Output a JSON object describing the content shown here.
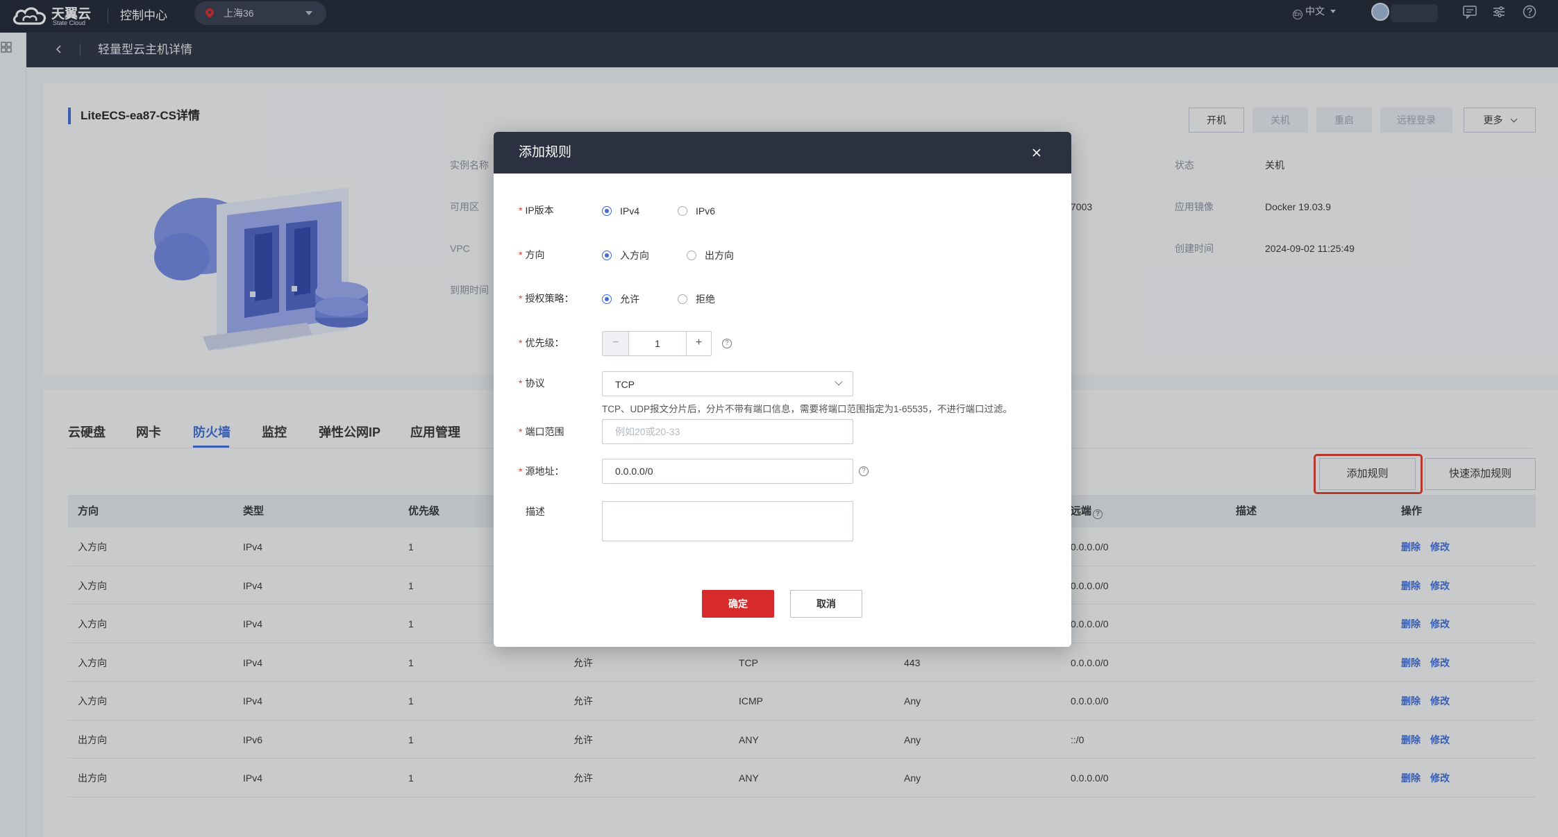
{
  "topbar": {
    "brand_name": "天翼云",
    "brand_sub": "State Cloud",
    "console_label": "控制中心",
    "region_label": "上海36",
    "language_label": "中文",
    "language_icon_text": "En"
  },
  "subbar": {
    "title": "轻量型云主机详情"
  },
  "detail": {
    "title": "LiteECS-ea87-CS详情",
    "fields_left": [
      {
        "label": "实例名称"
      },
      {
        "label": "可用区"
      },
      {
        "label": "VPC"
      },
      {
        "label": "到期时间"
      }
    ],
    "partial_value": "7003",
    "fields_right": [
      {
        "label": "状态",
        "value": "关机"
      },
      {
        "label": "应用镜像",
        "value": "Docker 19.03.9"
      },
      {
        "label": "创建时间",
        "value": "2024-09-02 11:25:49"
      }
    ],
    "buttons": {
      "start": "开机",
      "shutdown": "关机",
      "restart": "重启",
      "remote_login": "远程登录",
      "more": "更多"
    }
  },
  "tabs": [
    {
      "label": "云硬盘"
    },
    {
      "label": "网卡"
    },
    {
      "label": "防火墙"
    },
    {
      "label": "监控"
    },
    {
      "label": "弹性公网IP"
    },
    {
      "label": "应用管理"
    }
  ],
  "firewall": {
    "add_rule_label": "添加规则",
    "quick_add_label": "快速添加规则",
    "columns": {
      "direction": "方向",
      "type": "类型",
      "priority": "优先级",
      "remote": "远端",
      "description": "描述",
      "actions": "操作"
    },
    "delete_label": "删除",
    "edit_label": "修改",
    "rows": [
      {
        "direction": "入方向",
        "type": "IPv4",
        "priority": "1",
        "policy": "",
        "protocol": "",
        "port": "",
        "remote": "0.0.0.0/0"
      },
      {
        "direction": "入方向",
        "type": "IPv4",
        "priority": "1",
        "policy": "",
        "protocol": "",
        "port": "",
        "remote": "0.0.0.0/0"
      },
      {
        "direction": "入方向",
        "type": "IPv4",
        "priority": "1",
        "policy": "",
        "protocol": "",
        "port": "",
        "remote": "0.0.0.0/0"
      },
      {
        "direction": "入方向",
        "type": "IPv4",
        "priority": "1",
        "policy": "允许",
        "protocol": "TCP",
        "port": "443",
        "remote": "0.0.0.0/0"
      },
      {
        "direction": "入方向",
        "type": "IPv4",
        "priority": "1",
        "policy": "允许",
        "protocol": "ICMP",
        "port": "Any",
        "remote": "0.0.0.0/0"
      },
      {
        "direction": "出方向",
        "type": "IPv6",
        "priority": "1",
        "policy": "允许",
        "protocol": "ANY",
        "port": "Any",
        "remote": "::/0"
      },
      {
        "direction": "出方向",
        "type": "IPv4",
        "priority": "1",
        "policy": "允许",
        "protocol": "ANY",
        "port": "Any",
        "remote": "0.0.0.0/0"
      }
    ]
  },
  "modal": {
    "title": "添加规则",
    "ip_version": {
      "label": "IP版本",
      "options": [
        "IPv4",
        "IPv6"
      ],
      "selected": "IPv4"
    },
    "direction": {
      "label": "方向",
      "options": [
        "入方向",
        "出方向"
      ],
      "selected": "入方向"
    },
    "policy": {
      "label": "授权策略：",
      "options": [
        "允许",
        "拒绝"
      ],
      "selected": "允许"
    },
    "priority": {
      "label": "优先级：",
      "value": "1",
      "minus": "−",
      "plus": "+"
    },
    "protocol": {
      "label": "协议",
      "value": "TCP",
      "hint": "TCP、UDP报文分片后，分片不带有端口信息，需要将端口范围指定为1-65535，不进行端口过滤。"
    },
    "port_range": {
      "label": "端口范围",
      "placeholder": "例如20或20-33",
      "value": ""
    },
    "source": {
      "label": "源地址：",
      "value": "0.0.0.0/0"
    },
    "description": {
      "label": "描述",
      "value": ""
    },
    "ok_label": "确定",
    "cancel_label": "取消",
    "required_mark": "*"
  },
  "colors": {
    "accent": "#3d6cd8",
    "primary_button": "#d72a2a",
    "highlight": "#e03a2e",
    "topbar": "#1e2433"
  }
}
